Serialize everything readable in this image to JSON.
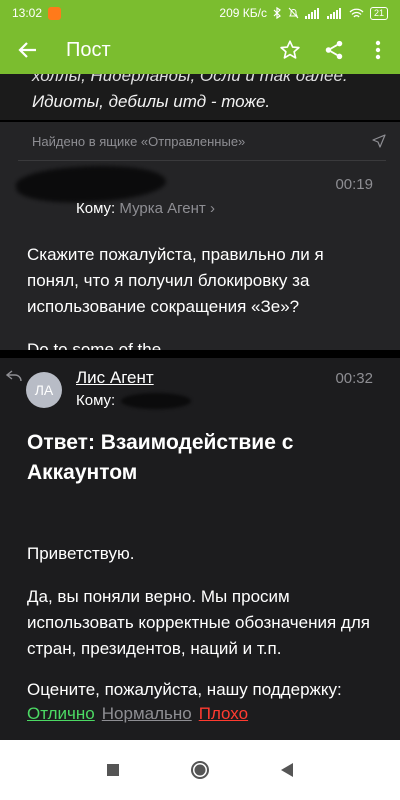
{
  "status_bar": {
    "time": "13:02",
    "speed": "209 КБ/с",
    "battery": "21"
  },
  "app_bar": {
    "title": "Пост",
    "icons": [
      "back-arrow-icon",
      "star-icon",
      "share-icon",
      "more-vert-icon"
    ]
  },
  "prev_text": {
    "line1": "холлы, Нидерланды, Осли и так далее.",
    "line2": "Идиоты, дебилы итд - тоже."
  },
  "message1": {
    "found_in": "Найдено в ящике «Отправленные»",
    "time": "00:19",
    "to_label": "Кому:",
    "to_name": "Мурка Агент",
    "body": "Скажите пожалуйста, правильно ли я понял, что я получил блокировку за использование сокращения «Зе»?",
    "cut_text": "Do to some of the"
  },
  "message2": {
    "avatar": "ЛА",
    "sender": "Лис Агент",
    "time": "00:32",
    "to_label": "Кому:",
    "subject": "Ответ: Взаимодействие с Аккаунтом",
    "greeting": "Приветствую.",
    "paragraph": "Да, вы поняли верно. Мы просим использовать корректные обозначения для стран, президентов, наций и т.п.",
    "rate_question": "Оцените, пожалуйста, нашу поддержку:",
    "rate_good": "Отлично",
    "rate_normal": "Нормально",
    "rate_bad": "Плохо"
  },
  "colors": {
    "accent": "#7bbd2f",
    "good": "#4cd964",
    "normal": "#8e8e93",
    "bad": "#ff3b30"
  }
}
